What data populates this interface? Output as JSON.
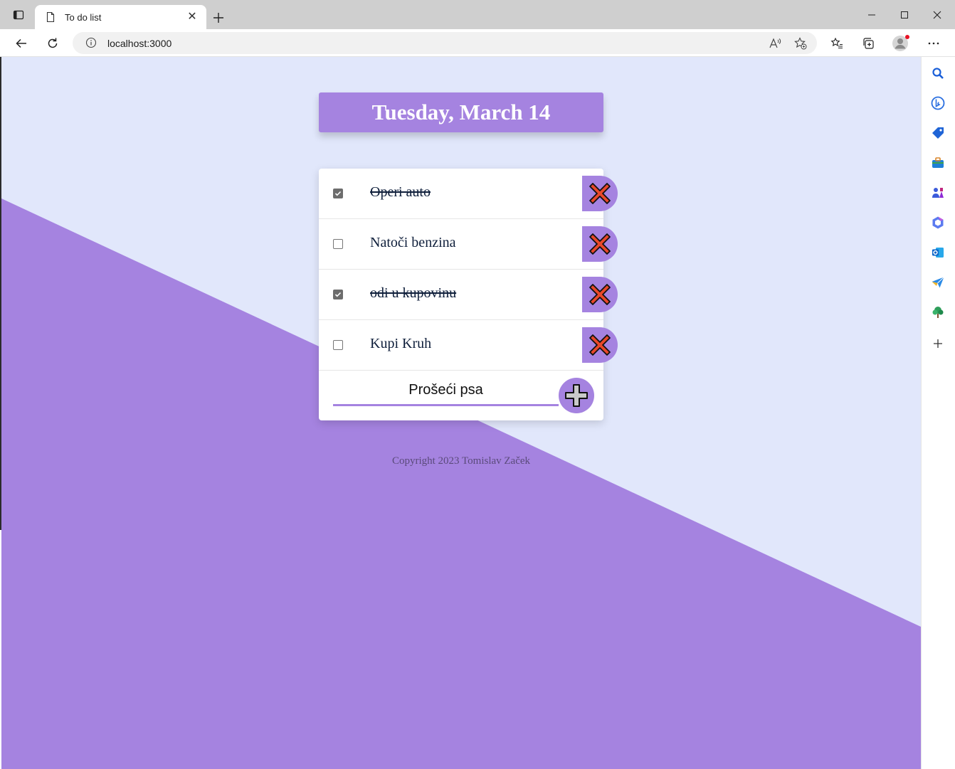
{
  "browser": {
    "tab_title": "To do list",
    "url": "localhost:3000"
  },
  "app": {
    "date_heading": "Tuesday, March 14",
    "items": [
      {
        "text": "Operi auto",
        "checked": true
      },
      {
        "text": "Natoči benzina",
        "checked": false
      },
      {
        "text": "odi u kupovinu",
        "checked": true
      },
      {
        "text": "Kupi Kruh",
        "checked": false
      }
    ],
    "new_item_value": "Prošeći psa",
    "footer": "Copyright 2023 Tomislav Začek"
  },
  "colors": {
    "accent": "#a583e0",
    "background_light": "#e1e7fb",
    "delete_icon": "#e8482a"
  },
  "icons": {
    "sidebar": [
      "search-icon",
      "bing-icon",
      "tag-icon",
      "briefcase-icon",
      "games-icon",
      "office-icon",
      "outlook-icon",
      "send-icon",
      "tree-icon",
      "add-icon"
    ]
  }
}
